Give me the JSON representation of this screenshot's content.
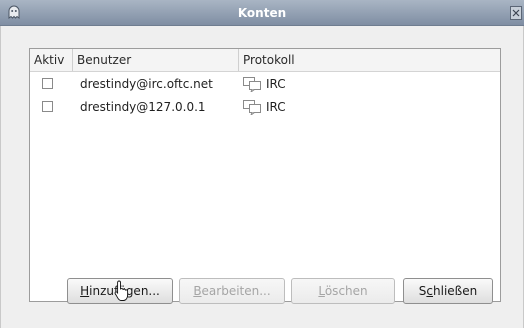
{
  "window": {
    "title": "Konten"
  },
  "table": {
    "columns": [
      "Aktiv",
      "Benutzer",
      "Protokoll"
    ],
    "rows": [
      {
        "active": false,
        "user": "drestindy@irc.oftc.net",
        "protocol": "IRC"
      },
      {
        "active": false,
        "user": "drestindy@127.0.0.1",
        "protocol": "IRC"
      }
    ]
  },
  "buttons": {
    "add": {
      "pre": "",
      "mnemonic": "H",
      "post": "inzufügen..."
    },
    "edit": {
      "pre": "",
      "mnemonic": "B",
      "post": "earbeiten..."
    },
    "delete": {
      "pre": "",
      "mnemonic": "L",
      "post": "öschen"
    },
    "close": {
      "pre": "S",
      "mnemonic": "c",
      "post": "hließen"
    }
  },
  "icons": {
    "app": "ghost-icon",
    "close": "close-icon",
    "protocol": "chat-bubbles-icon",
    "cursor": "pointer-cursor-icon"
  },
  "colors": {
    "titlebar": "#8e9bad",
    "disabled_text": "#a5a5a5"
  }
}
